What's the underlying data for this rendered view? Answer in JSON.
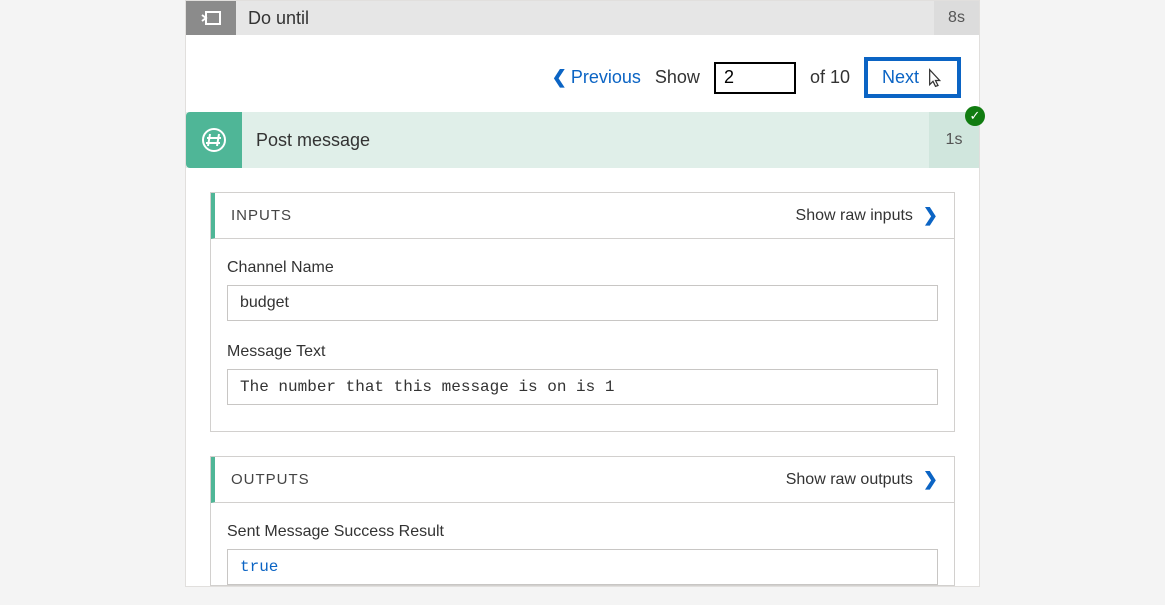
{
  "header": {
    "title": "Do until",
    "duration": "8s"
  },
  "pager": {
    "previous": "Previous",
    "show_label": "Show",
    "current": "2",
    "of_label": "of 10",
    "next": "Next"
  },
  "action": {
    "title": "Post message",
    "duration": "1s"
  },
  "inputs": {
    "title": "INPUTS",
    "show_raw": "Show raw inputs",
    "fields": {
      "channel_name_label": "Channel Name",
      "channel_name_value": "budget",
      "message_text_label": "Message Text",
      "message_text_value": "The number that this message is on is 1"
    }
  },
  "outputs": {
    "title": "OUTPUTS",
    "show_raw": "Show raw outputs",
    "fields": {
      "sent_success_label": "Sent Message Success Result",
      "sent_success_value": "true"
    }
  }
}
